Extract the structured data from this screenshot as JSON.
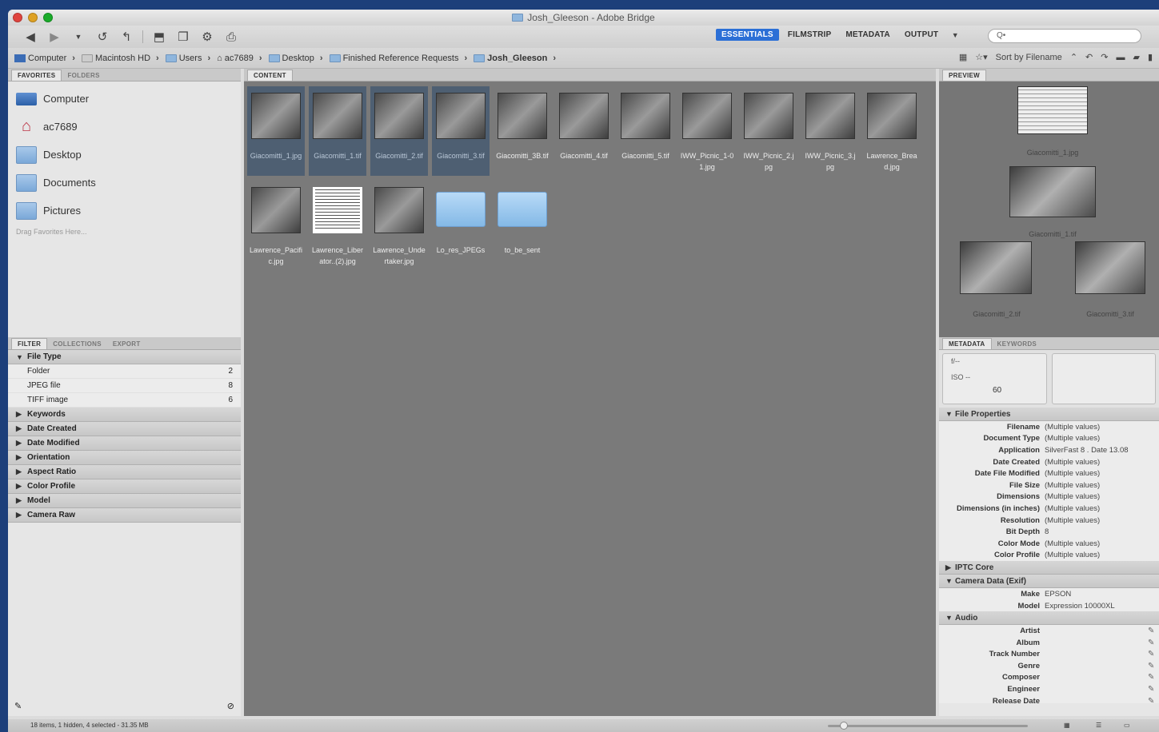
{
  "window": {
    "title": "Josh_Gleeson - Adobe Bridge",
    "traffic_colors": [
      "#e0443e",
      "#dea123",
      "#1aab29"
    ]
  },
  "toolbar": {
    "workspaces": [
      "ESSENTIALS",
      "FILMSTRIP",
      "METADATA",
      "OUTPUT"
    ],
    "active_workspace": "ESSENTIALS",
    "search_placeholder": "Q•",
    "accent": "#2b6fd6"
  },
  "path": {
    "crumbs": [
      "Computer",
      "Macintosh HD",
      "Users",
      "ac7689",
      "Desktop",
      "Finished Reference Requests",
      "Josh_Gleeson"
    ],
    "sort_label": "Sort by Filename"
  },
  "left": {
    "tabs": [
      "FAVORITES",
      "FOLDERS"
    ],
    "favorites": [
      "Computer",
      "ac7689",
      "Desktop",
      "Documents",
      "Pictures"
    ],
    "drag_hint": "Drag Favorites Here...",
    "filter_tabs": [
      "FILTER",
      "COLLECTIONS",
      "EXPORT"
    ],
    "filter_sections": {
      "file_type": "File Type",
      "file_type_items": [
        {
          "label": "Folder",
          "count": "2"
        },
        {
          "label": "JPEG file",
          "count": "8"
        },
        {
          "label": "TIFF image",
          "count": "6"
        }
      ],
      "collapsed": [
        "Keywords",
        "Date Created",
        "Date Modified",
        "Orientation",
        "Aspect Ratio",
        "Color Profile",
        "Model",
        "Camera Raw"
      ]
    }
  },
  "content": {
    "tab": "CONTENT",
    "items": [
      {
        "name": "Giacomitti_1.jpg",
        "kind": "photo",
        "selected": true
      },
      {
        "name": "Giacomitti_1.tif",
        "kind": "photo",
        "selected": true
      },
      {
        "name": "Giacomitti_2.tif",
        "kind": "photo",
        "selected": true
      },
      {
        "name": "Giacomitti_3.tif",
        "kind": "photo",
        "selected": true
      },
      {
        "name": "Giacomitti_3B.tif",
        "kind": "photo",
        "selected": false
      },
      {
        "name": "Giacomitti_4.tif",
        "kind": "photo",
        "selected": false
      },
      {
        "name": "Giacomitti_5.tif",
        "kind": "photo",
        "selected": false
      },
      {
        "name": "IWW_Picnic_1-01.jpg",
        "kind": "photo",
        "selected": false
      },
      {
        "name": "IWW_Picnic_2.jpg",
        "kind": "photo",
        "selected": false
      },
      {
        "name": "IWW_Picnic_3.jpg",
        "kind": "photo",
        "selected": false
      },
      {
        "name": "Lawrence_Bread.jpg",
        "kind": "photo",
        "selected": false
      },
      {
        "name": "Lawrence_Pacific.jpg",
        "kind": "photo",
        "selected": false
      },
      {
        "name": "Lawrence_Liberator..(2).jpg",
        "kind": "doc",
        "selected": false
      },
      {
        "name": "Lawrence_Undertaker.jpg",
        "kind": "photo",
        "selected": false
      },
      {
        "name": "Lo_res_JPEGs",
        "kind": "folder",
        "selected": false
      },
      {
        "name": "to_be_sent",
        "kind": "folder",
        "selected": false
      }
    ]
  },
  "right": {
    "preview_tab": "PREVIEW",
    "preview_captions": [
      "Giacomitti_1.jpg",
      "Giacomitti_1.tif",
      "Giacomitti_2.tif",
      "Giacomitti_3.tif"
    ],
    "meta_tabs": [
      "METADATA",
      "KEYWORDS"
    ],
    "meta_box": {
      "aperture": "f/--",
      "iso": "ISO --",
      "res": "60"
    },
    "file_properties_title": "File Properties",
    "file_properties": [
      {
        "k": "Filename",
        "v": "(Multiple values)"
      },
      {
        "k": "Document Type",
        "v": "(Multiple values)"
      },
      {
        "k": "Application",
        "v": "SilverFast 8 . Date 13.08"
      },
      {
        "k": "Date Created",
        "v": "(Multiple values)"
      },
      {
        "k": "Date File Modified",
        "v": "(Multiple values)"
      },
      {
        "k": "File Size",
        "v": "(Multiple values)"
      },
      {
        "k": "Dimensions",
        "v": "(Multiple values)"
      },
      {
        "k": "Dimensions (in inches)",
        "v": "(Multiple values)"
      },
      {
        "k": "Resolution",
        "v": "(Multiple values)"
      },
      {
        "k": "Bit Depth",
        "v": "8"
      },
      {
        "k": "Color Mode",
        "v": "(Multiple values)"
      },
      {
        "k": "Color Profile",
        "v": "(Multiple values)"
      }
    ],
    "iptc_title": "IPTC Core",
    "camera_title": "Camera Data (Exif)",
    "camera": [
      {
        "k": "Make",
        "v": "EPSON"
      },
      {
        "k": "Model",
        "v": "Expression 10000XL"
      }
    ],
    "audio_title": "Audio",
    "audio": [
      "Artist",
      "Album",
      "Track Number",
      "Genre",
      "Composer",
      "Engineer",
      "Release Date"
    ]
  },
  "status": {
    "text": "18 items, 1 hidden, 4 selected - 31.35 MB",
    "thumb_zoom": 0.06
  }
}
